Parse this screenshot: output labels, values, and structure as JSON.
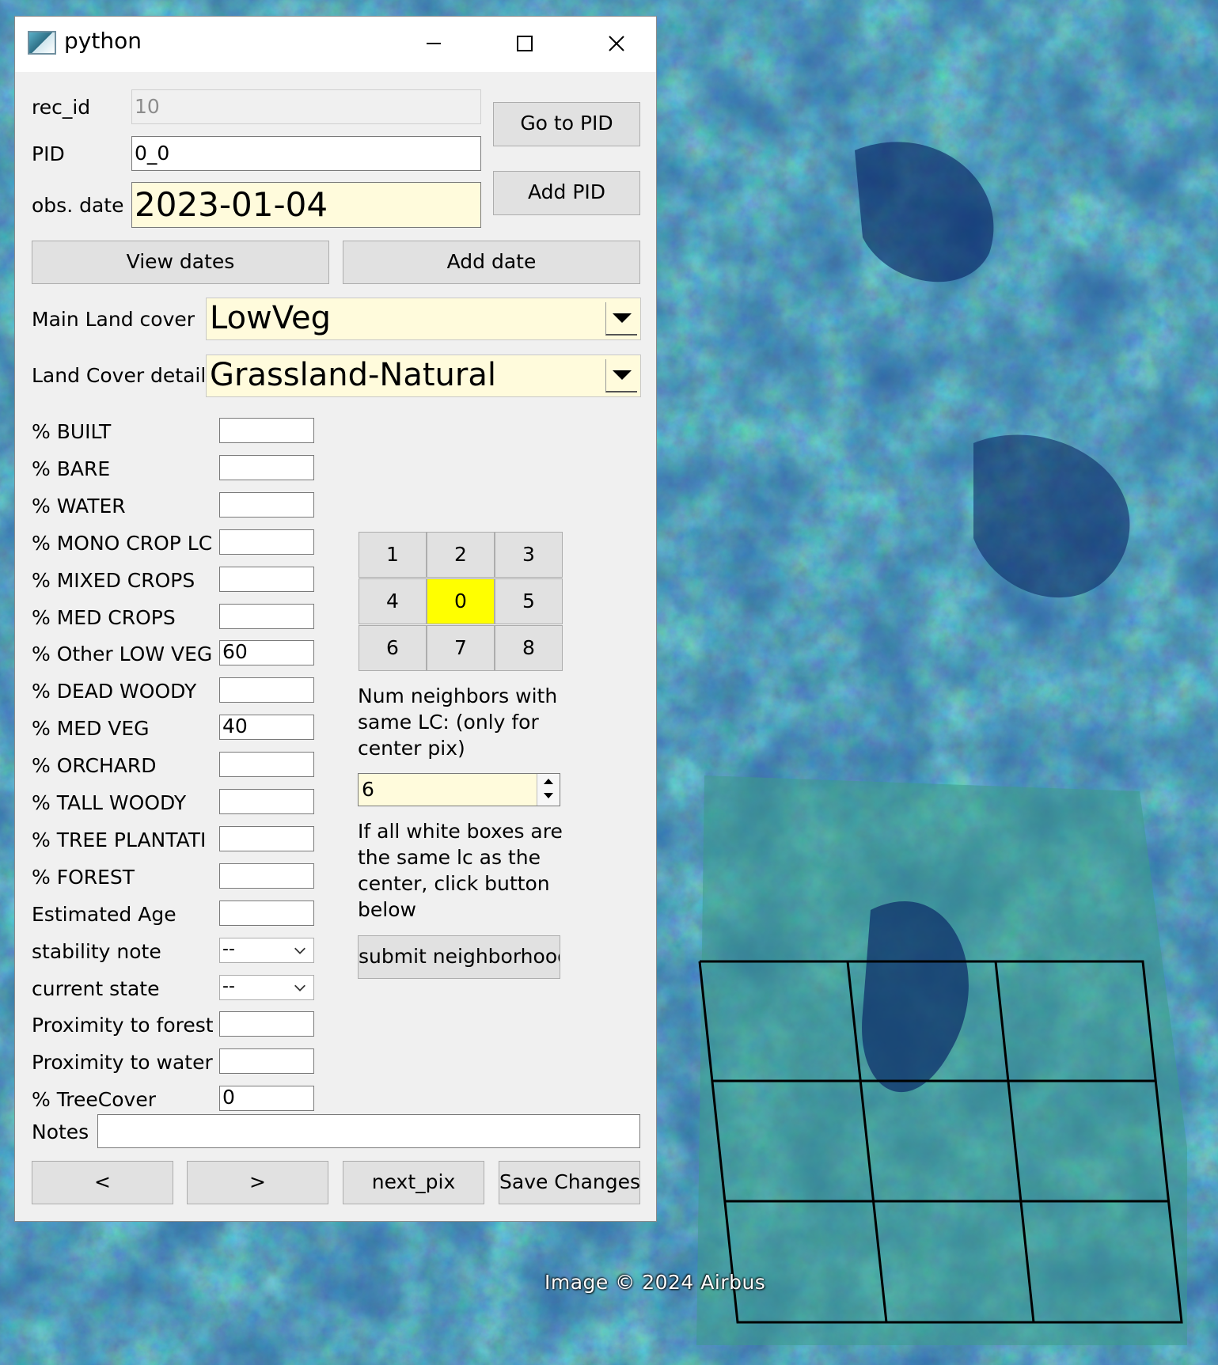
{
  "window": {
    "title": "python",
    "icon": "python-window-icon",
    "controls": [
      "minimize-icon",
      "maximize-icon",
      "close-icon"
    ]
  },
  "record": {
    "rec_id_label": "rec_id",
    "rec_id_value": "10",
    "pid_label": "PID",
    "pid_value": "0_0",
    "obs_date_label": "obs. date",
    "obs_date_value": "2023-01-04"
  },
  "buttons": {
    "go_to_pid": "Go to PID",
    "add_pid": "Add PID",
    "view_dates": "View dates",
    "add_date": "Add date",
    "submit_neighborhood": "submit neighborhood",
    "prev": "<",
    "next": ">",
    "next_pix": "next_pix",
    "save_changes": "Save Changes"
  },
  "landcover": {
    "main_label": "Main Land cover",
    "main_value": "LowVeg",
    "detail_label": "Land Cover detail",
    "detail_value": "Grassland-Natural"
  },
  "fields": [
    {
      "label": "% BUILT",
      "value": ""
    },
    {
      "label": "% BARE",
      "value": ""
    },
    {
      "label": "% WATER",
      "value": ""
    },
    {
      "label": "% MONO CROP LC",
      "value": ""
    },
    {
      "label": "% MIXED CROPS",
      "value": ""
    },
    {
      "label": "% MED CROPS",
      "value": ""
    },
    {
      "label": "% Other LOW VEG",
      "value": "60"
    },
    {
      "label": "% DEAD WOODY",
      "value": ""
    },
    {
      "label": "% MED VEG",
      "value": "40"
    },
    {
      "label": "% ORCHARD",
      "value": ""
    },
    {
      "label": "% TALL WOODY",
      "value": ""
    },
    {
      "label": "% TREE PLANTATI",
      "value": ""
    },
    {
      "label": "% FOREST",
      "value": ""
    },
    {
      "label": "Estimated Age",
      "value": ""
    },
    {
      "label": "stability note",
      "value": "--"
    },
    {
      "label": "current state",
      "value": "--"
    },
    {
      "label": "Proximity to forest",
      "value": ""
    },
    {
      "label": "Proximity to water",
      "value": ""
    },
    {
      "label": "% TreeCover",
      "value": "0"
    }
  ],
  "neighbor_grid": [
    "1",
    "2",
    "3",
    "4",
    "0",
    "5",
    "6",
    "7",
    "8"
  ],
  "neighbors": {
    "help_text": [
      "Num neighbors with",
      "same LC: (only for",
      "center pix)"
    ],
    "count": "6",
    "instruction": [
      "If all white boxes are",
      "the same lc as the",
      "center, click button",
      "below"
    ]
  },
  "notes": {
    "label": "Notes",
    "value": ""
  },
  "map": {
    "attribution": "Image © 2024 Airbus"
  },
  "colors": {
    "highlight": "#ffff00",
    "input_yellow": "#fffbdc",
    "window_bg": "#f0f0f0",
    "button_bg": "#e1e1e1"
  }
}
